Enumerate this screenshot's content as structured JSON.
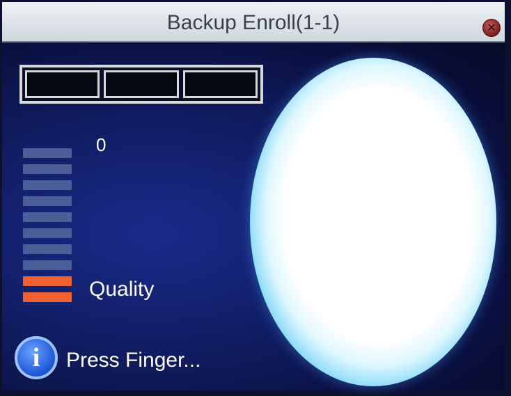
{
  "window": {
    "title": "Backup Enroll(1-1)",
    "close_icon": "close-icon"
  },
  "enroll": {
    "capture_slots": 3,
    "count": "0"
  },
  "quality_meter": {
    "label": "Quality",
    "segments_total": 10,
    "segments_lit": 2,
    "colors": {
      "lit": "#f06030",
      "unlit": "#4c5e97"
    }
  },
  "status": {
    "icon": "info-icon",
    "message": "Press Finger..."
  },
  "sensor": {
    "icon": "fingerprint-sensor-glow"
  }
}
